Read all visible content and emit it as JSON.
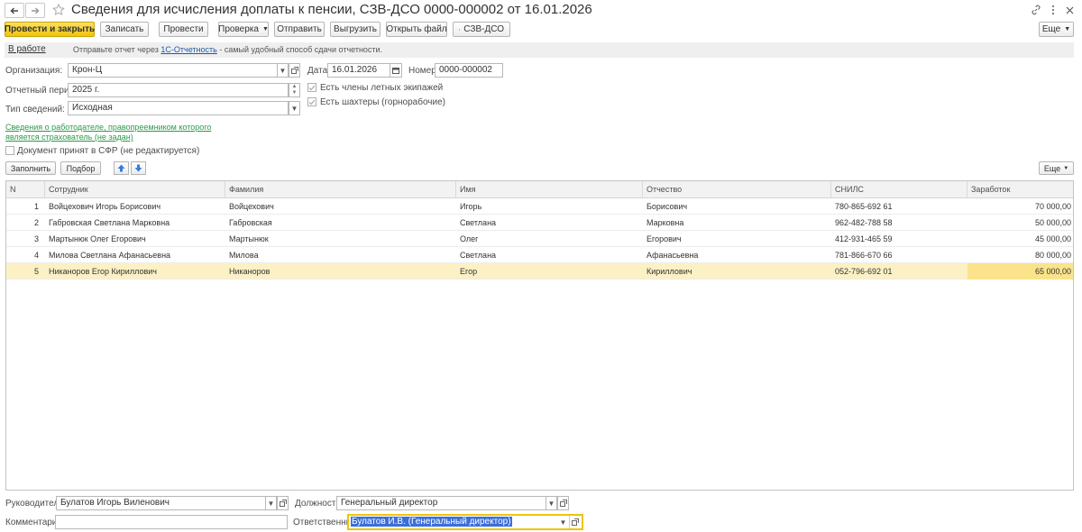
{
  "header": {
    "title": "Сведения для исчисления доплаты к пенсии, СЗВ-ДСО 0000-000002 от 16.01.2026"
  },
  "toolbar": {
    "post_close": "Провести и закрыть",
    "save": "Записать",
    "post": "Провести",
    "check": "Проверка",
    "send": "Отправить",
    "export": "Выгрузить",
    "open_file": "Открыть файл",
    "print_form": "СЗВ-ДСО",
    "more": "Еще"
  },
  "infobar": {
    "status": "В работе",
    "text_before": "Отправьте отчет через ",
    "link": "1С-Отчетность",
    "text_after": " - самый удобный способ сдачи отчетности."
  },
  "form": {
    "org_label": "Организация:",
    "org_value": "Крон-Ц",
    "date_label": "Дата:",
    "date_value": "16.01.2026",
    "number_label": "Номер:",
    "number_value": "0000-000002",
    "period_label": "Отчетный период:",
    "period_value": "2025 г.",
    "flight_crew_label": "Есть члены летных экипажей",
    "miners_label": "Есть шахтеры (горнорабочие)",
    "type_label": "Тип сведений:",
    "type_value": "Исходная",
    "successor_link": "Сведения о работодателе, правопреемником которого является страхователь (не задан)",
    "accepted_label": "Документ принят в СФР (не редактируется)"
  },
  "table_toolbar": {
    "fill": "Заполнить",
    "select": "Подбор",
    "more": "Еще"
  },
  "table": {
    "columns": [
      "N",
      "Сотрудник",
      "Фамилия",
      "Имя",
      "Отчество",
      "СНИЛС",
      "Заработок"
    ],
    "rows": [
      {
        "n": "1",
        "employee": "Войцехович Игорь Борисович",
        "last": "Войцехович",
        "first": "Игорь",
        "middle": "Борисович",
        "snils": "780-865-692 61",
        "earnings": "70 000,00"
      },
      {
        "n": "2",
        "employee": "Габровская Светлана Марковна",
        "last": "Габровская",
        "first": "Светлана",
        "middle": "Марковна",
        "snils": "962-482-788 58",
        "earnings": "50 000,00"
      },
      {
        "n": "3",
        "employee": "Мартынюк Олег Егорович",
        "last": "Мартынюк",
        "first": "Олег",
        "middle": "Егорович",
        "snils": "412-931-465 59",
        "earnings": "45 000,00"
      },
      {
        "n": "4",
        "employee": "Милова Светлана Афанасьевна",
        "last": "Милова",
        "first": "Светлана",
        "middle": "Афанасьевна",
        "snils": "781-866-670 66",
        "earnings": "80 000,00"
      },
      {
        "n": "5",
        "employee": "Никаноров Егор Кириллович",
        "last": "Никаноров",
        "first": "Егор",
        "middle": "Кириллович",
        "snils": "052-796-692 01",
        "earnings": "65 000,00"
      }
    ]
  },
  "footer": {
    "head_label": "Руководитель:",
    "head_value": "Булатов Игорь Виленович",
    "position_label": "Должность:",
    "position_value": "Генеральный директор",
    "comment_label": "Комментарий:",
    "comment_value": "",
    "responsible_label": "Ответственный:",
    "responsible_value": "Булатов И.В. (Генеральный директор)"
  },
  "colors": {
    "primary_button": "#f0c40b",
    "selected_row": "#fcf1c4",
    "link_blue": "#1e5aa8",
    "link_green": "#2c9a49",
    "focus_border": "#f0c40b"
  },
  "icons": [
    "back-arrow-icon",
    "forward-arrow-icon",
    "star-icon",
    "link-icon",
    "menu-dots-icon",
    "close-icon",
    "printer-icon",
    "calendar-icon",
    "open-icon",
    "move-up-icon",
    "move-down-icon"
  ]
}
